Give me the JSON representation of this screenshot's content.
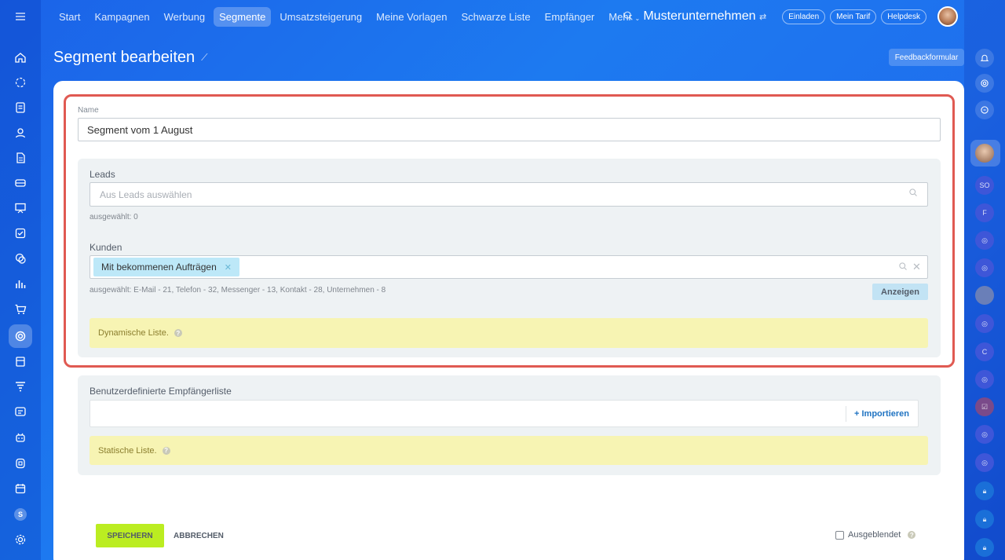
{
  "topnav": {
    "items": [
      "Start",
      "Kampagnen",
      "Werbung",
      "Segmente",
      "Umsatzsteigerung",
      "Meine Vorlagen",
      "Schwarze Liste",
      "Empfänger",
      "Mehr"
    ],
    "active_index": 3,
    "company": "Musterunternehmen",
    "invite": "Einladen",
    "plan": "Mein Tarif",
    "helpdesk": "Helpdesk"
  },
  "page": {
    "title": "Segment bearbeiten",
    "feedback": "Feedbackformular"
  },
  "left_sidebar": {
    "icons": [
      "menu-icon",
      "home-icon",
      "chat-icon",
      "tasks-icon",
      "contacts-icon",
      "document-icon",
      "card-icon",
      "presentation-icon",
      "checkbox-icon",
      "messages-icon",
      "chart-icon",
      "cart-icon",
      "marketing-icon",
      "building-icon",
      "funnel-icon",
      "list-icon",
      "robot-icon",
      "shield-icon",
      "calendar-icon",
      "user-avatar",
      "settings-icon"
    ],
    "user_initial": "S"
  },
  "right_sidebar": {
    "initials": [
      "SO",
      "F",
      "C"
    ]
  },
  "form": {
    "name_label": "Name",
    "name_value": "Segment vom 1 August",
    "leads": {
      "label": "Leads",
      "placeholder": "Aus Leads auswählen",
      "selected": "ausgewählt:  0"
    },
    "kunden": {
      "label": "Kunden",
      "tag": "Mit bekommenen Aufträgen",
      "selected": "ausgewählt:   E-Mail - 21,   Telefon - 32,   Messenger - 13,   Kontakt - 28,   Unternehmen - 8",
      "show_button": "Anzeigen"
    },
    "dynamic_list": "Dynamische Liste.",
    "custom": {
      "label": "Benutzerdefinierte Empfängerliste",
      "import": "+ Importieren",
      "static_list": "Statische Liste."
    },
    "save": "SPEICHERN",
    "cancel": "ABBRECHEN",
    "hidden": "Ausgeblendet"
  },
  "colors": {
    "accent": "#1f73c2",
    "save_bg": "#bbed21",
    "highlight_border": "#e05a52",
    "tag_bg": "#bde8f8",
    "notice_bg": "#f7f4b3"
  }
}
